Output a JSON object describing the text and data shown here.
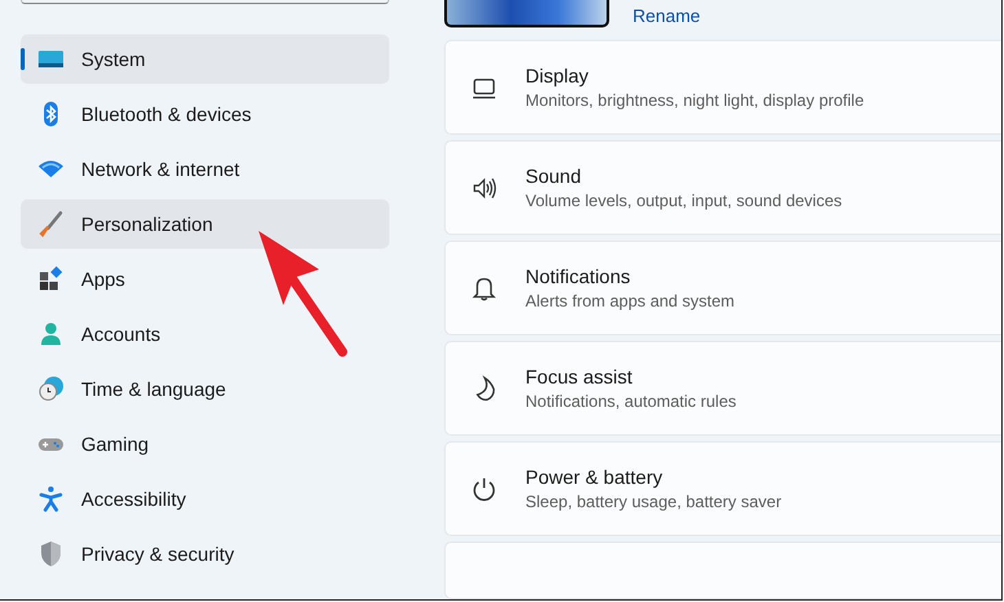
{
  "nav": [
    {
      "label": "System",
      "selected": true,
      "hovered": false
    },
    {
      "label": "Bluetooth & devices",
      "selected": false,
      "hovered": false
    },
    {
      "label": "Network & internet",
      "selected": false,
      "hovered": false
    },
    {
      "label": "Personalization",
      "selected": false,
      "hovered": true
    },
    {
      "label": "Apps",
      "selected": false,
      "hovered": false
    },
    {
      "label": "Accounts",
      "selected": false,
      "hovered": false
    },
    {
      "label": "Time & language",
      "selected": false,
      "hovered": false
    },
    {
      "label": "Gaming",
      "selected": false,
      "hovered": false
    },
    {
      "label": "Accessibility",
      "selected": false,
      "hovered": false
    },
    {
      "label": "Privacy & security",
      "selected": false,
      "hovered": false
    }
  ],
  "device": {
    "rename_link": "Rename"
  },
  "settings": [
    {
      "title": "Display",
      "subtitle": "Monitors, brightness, night light, display profile"
    },
    {
      "title": "Sound",
      "subtitle": "Volume levels, output, input, sound devices"
    },
    {
      "title": "Notifications",
      "subtitle": "Alerts from apps and system"
    },
    {
      "title": "Focus assist",
      "subtitle": "Notifications, automatic rules"
    },
    {
      "title": "Power & battery",
      "subtitle": "Sleep, battery usage, battery saver"
    }
  ]
}
